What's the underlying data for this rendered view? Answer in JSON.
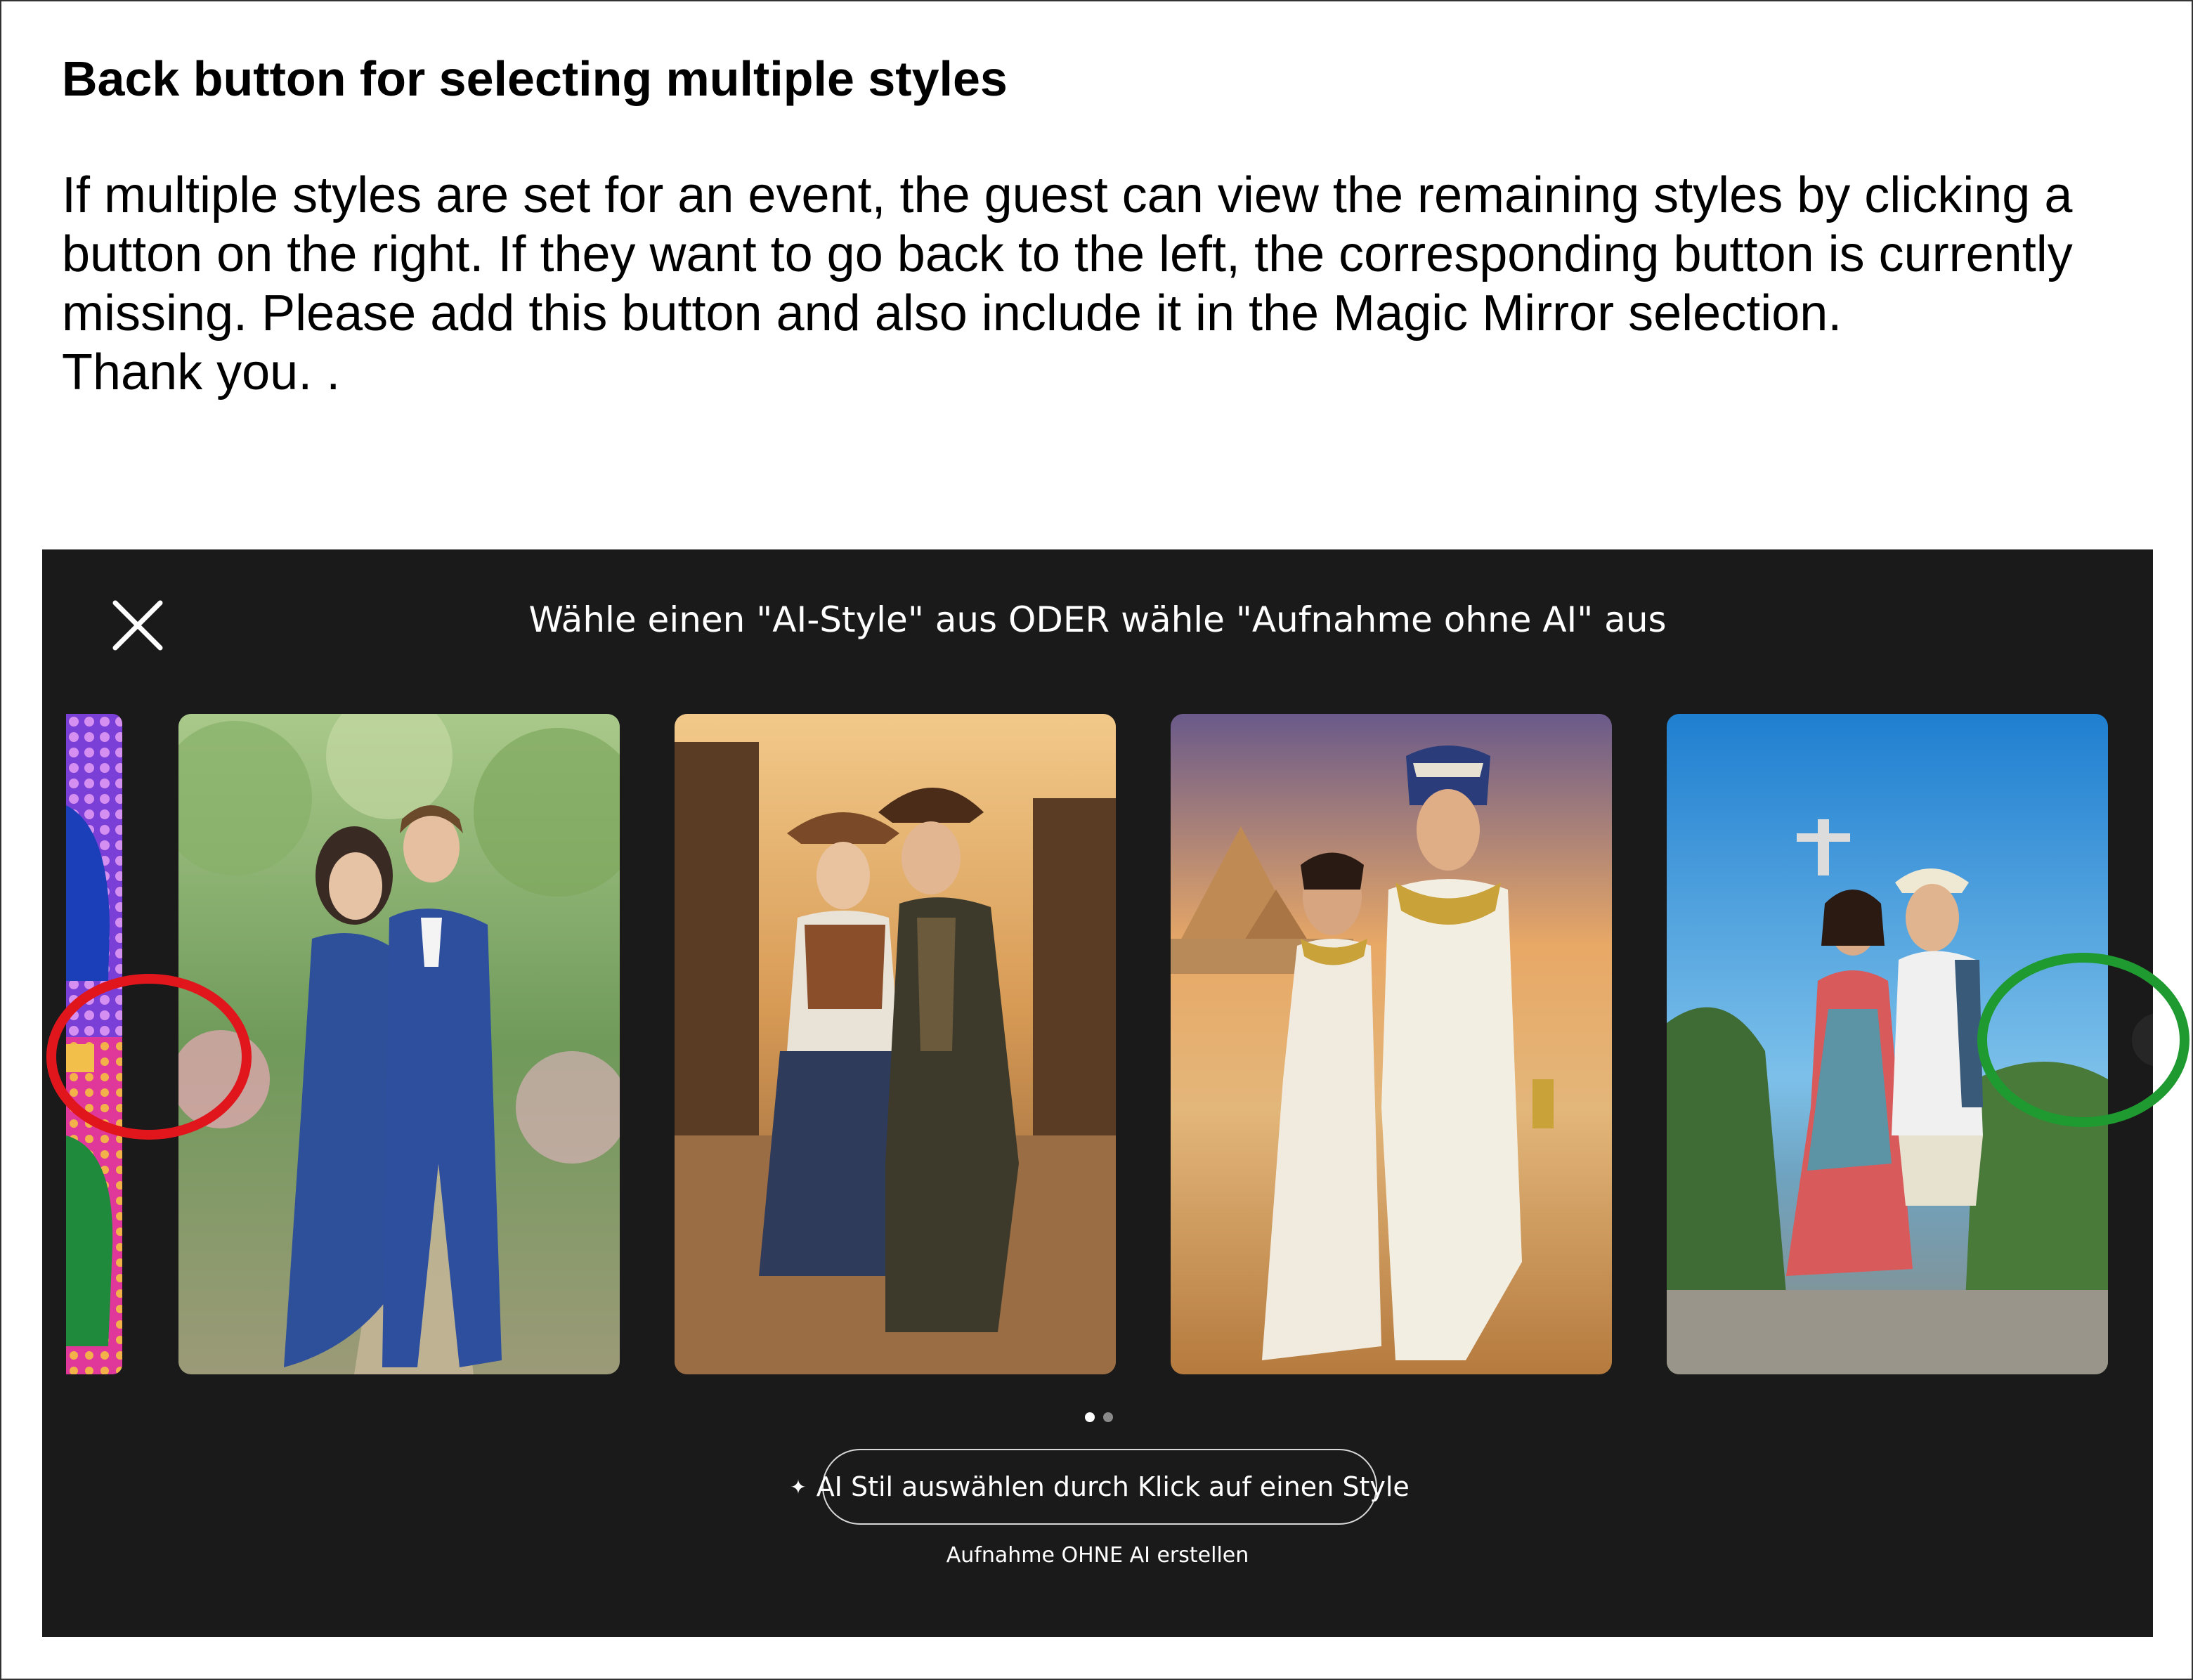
{
  "document": {
    "title": "Back button for selecting multiple styles",
    "body_lines": [
      "If multiple styles are set for an event, the guest can view the remaining styles by clicking a",
      "button on the right. If they want to go back to the left, the corresponding button is currently",
      "missing. Please add this button and also include it in the Magic Mirror selection.",
      "Thank you. ."
    ]
  },
  "app": {
    "heading": "Wähle einen \"AI-Style\" aus ODER wähle \"Aufnahme ohne AI\" aus",
    "close_icon": "close-icon",
    "next_icon": "chevron-right-icon",
    "carousel": {
      "page_count": 2,
      "active_page": 1
    },
    "select_button_label": "AI Stil auswählen durch Klick auf einen Style",
    "select_button_icon": "sparkle-icon",
    "no_ai_link": "Aufnahme OHNE AI erstellen"
  },
  "annotations": {
    "missing_back_button_color": "#e0161c",
    "existing_next_button_color": "#1f9a31"
  },
  "colors": {
    "app_background": "#1a1a1a",
    "text": "#ffffff"
  }
}
